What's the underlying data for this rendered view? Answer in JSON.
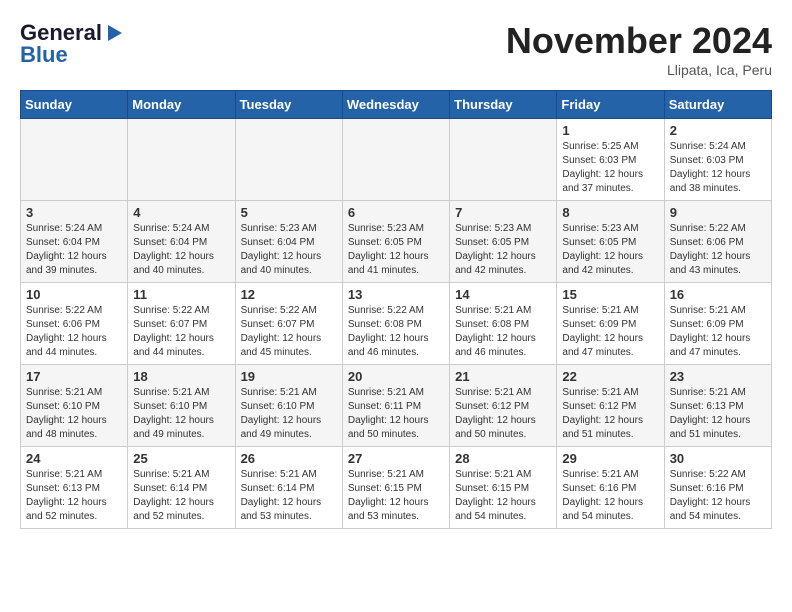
{
  "logo": {
    "line1": "General",
    "line2": "Blue"
  },
  "title": "November 2024",
  "location": "Llipata, Ica, Peru",
  "days_of_week": [
    "Sunday",
    "Monday",
    "Tuesday",
    "Wednesday",
    "Thursday",
    "Friday",
    "Saturday"
  ],
  "weeks": [
    [
      {
        "day": "",
        "info": ""
      },
      {
        "day": "",
        "info": ""
      },
      {
        "day": "",
        "info": ""
      },
      {
        "day": "",
        "info": ""
      },
      {
        "day": "",
        "info": ""
      },
      {
        "day": "1",
        "info": "Sunrise: 5:25 AM\nSunset: 6:03 PM\nDaylight: 12 hours\nand 37 minutes."
      },
      {
        "day": "2",
        "info": "Sunrise: 5:24 AM\nSunset: 6:03 PM\nDaylight: 12 hours\nand 38 minutes."
      }
    ],
    [
      {
        "day": "3",
        "info": "Sunrise: 5:24 AM\nSunset: 6:04 PM\nDaylight: 12 hours\nand 39 minutes."
      },
      {
        "day": "4",
        "info": "Sunrise: 5:24 AM\nSunset: 6:04 PM\nDaylight: 12 hours\nand 40 minutes."
      },
      {
        "day": "5",
        "info": "Sunrise: 5:23 AM\nSunset: 6:04 PM\nDaylight: 12 hours\nand 40 minutes."
      },
      {
        "day": "6",
        "info": "Sunrise: 5:23 AM\nSunset: 6:05 PM\nDaylight: 12 hours\nand 41 minutes."
      },
      {
        "day": "7",
        "info": "Sunrise: 5:23 AM\nSunset: 6:05 PM\nDaylight: 12 hours\nand 42 minutes."
      },
      {
        "day": "8",
        "info": "Sunrise: 5:23 AM\nSunset: 6:05 PM\nDaylight: 12 hours\nand 42 minutes."
      },
      {
        "day": "9",
        "info": "Sunrise: 5:22 AM\nSunset: 6:06 PM\nDaylight: 12 hours\nand 43 minutes."
      }
    ],
    [
      {
        "day": "10",
        "info": "Sunrise: 5:22 AM\nSunset: 6:06 PM\nDaylight: 12 hours\nand 44 minutes."
      },
      {
        "day": "11",
        "info": "Sunrise: 5:22 AM\nSunset: 6:07 PM\nDaylight: 12 hours\nand 44 minutes."
      },
      {
        "day": "12",
        "info": "Sunrise: 5:22 AM\nSunset: 6:07 PM\nDaylight: 12 hours\nand 45 minutes."
      },
      {
        "day": "13",
        "info": "Sunrise: 5:22 AM\nSunset: 6:08 PM\nDaylight: 12 hours\nand 46 minutes."
      },
      {
        "day": "14",
        "info": "Sunrise: 5:21 AM\nSunset: 6:08 PM\nDaylight: 12 hours\nand 46 minutes."
      },
      {
        "day": "15",
        "info": "Sunrise: 5:21 AM\nSunset: 6:09 PM\nDaylight: 12 hours\nand 47 minutes."
      },
      {
        "day": "16",
        "info": "Sunrise: 5:21 AM\nSunset: 6:09 PM\nDaylight: 12 hours\nand 47 minutes."
      }
    ],
    [
      {
        "day": "17",
        "info": "Sunrise: 5:21 AM\nSunset: 6:10 PM\nDaylight: 12 hours\nand 48 minutes."
      },
      {
        "day": "18",
        "info": "Sunrise: 5:21 AM\nSunset: 6:10 PM\nDaylight: 12 hours\nand 49 minutes."
      },
      {
        "day": "19",
        "info": "Sunrise: 5:21 AM\nSunset: 6:10 PM\nDaylight: 12 hours\nand 49 minutes."
      },
      {
        "day": "20",
        "info": "Sunrise: 5:21 AM\nSunset: 6:11 PM\nDaylight: 12 hours\nand 50 minutes."
      },
      {
        "day": "21",
        "info": "Sunrise: 5:21 AM\nSunset: 6:12 PM\nDaylight: 12 hours\nand 50 minutes."
      },
      {
        "day": "22",
        "info": "Sunrise: 5:21 AM\nSunset: 6:12 PM\nDaylight: 12 hours\nand 51 minutes."
      },
      {
        "day": "23",
        "info": "Sunrise: 5:21 AM\nSunset: 6:13 PM\nDaylight: 12 hours\nand 51 minutes."
      }
    ],
    [
      {
        "day": "24",
        "info": "Sunrise: 5:21 AM\nSunset: 6:13 PM\nDaylight: 12 hours\nand 52 minutes."
      },
      {
        "day": "25",
        "info": "Sunrise: 5:21 AM\nSunset: 6:14 PM\nDaylight: 12 hours\nand 52 minutes."
      },
      {
        "day": "26",
        "info": "Sunrise: 5:21 AM\nSunset: 6:14 PM\nDaylight: 12 hours\nand 53 minutes."
      },
      {
        "day": "27",
        "info": "Sunrise: 5:21 AM\nSunset: 6:15 PM\nDaylight: 12 hours\nand 53 minutes."
      },
      {
        "day": "28",
        "info": "Sunrise: 5:21 AM\nSunset: 6:15 PM\nDaylight: 12 hours\nand 54 minutes."
      },
      {
        "day": "29",
        "info": "Sunrise: 5:21 AM\nSunset: 6:16 PM\nDaylight: 12 hours\nand 54 minutes."
      },
      {
        "day": "30",
        "info": "Sunrise: 5:22 AM\nSunset: 6:16 PM\nDaylight: 12 hours\nand 54 minutes."
      }
    ]
  ]
}
